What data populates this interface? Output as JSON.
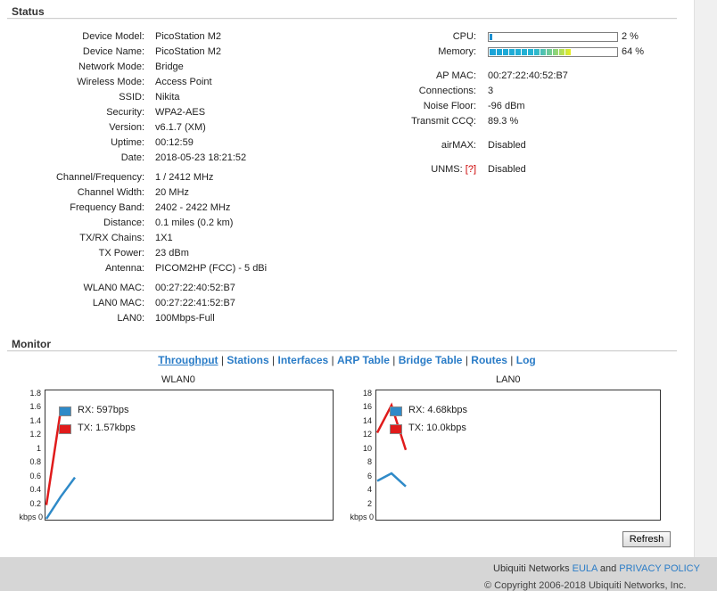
{
  "status": {
    "title": "Status",
    "left": [
      {
        "label": "Device Model:",
        "value": "PicoStation M2"
      },
      {
        "label": "Device Name:",
        "value": "PicoStation M2"
      },
      {
        "label": "Network Mode:",
        "value": "Bridge"
      },
      {
        "label": "Wireless Mode:",
        "value": "Access Point"
      },
      {
        "label": "SSID:",
        "value": "Nikita"
      },
      {
        "label": "Security:",
        "value": "WPA2-AES"
      },
      {
        "label": "Version:",
        "value": "v6.1.7 (XM)"
      },
      {
        "label": "Uptime:",
        "value": "00:12:59"
      },
      {
        "label": "Date:",
        "value": "2018-05-23 18:21:52"
      },
      {
        "label": "Channel/Frequency:",
        "value": "1 / 2412 MHz"
      },
      {
        "label": "Channel Width:",
        "value": "20 MHz"
      },
      {
        "label": "Frequency Band:",
        "value": "2402 - 2422 MHz"
      },
      {
        "label": "Distance:",
        "value": "0.1 miles (0.2 km)"
      },
      {
        "label": "TX/RX Chains:",
        "value": "1X1"
      },
      {
        "label": "TX Power:",
        "value": "23 dBm"
      },
      {
        "label": "Antenna:",
        "value": "PICOM2HP (FCC) - 5 dBi"
      },
      {
        "label": "WLAN0 MAC:",
        "value": "00:27:22:40:52:B7"
      },
      {
        "label": "LAN0 MAC:",
        "value": "00:27:22:41:52:B7"
      },
      {
        "label": "LAN0:",
        "value": "100Mbps-Full"
      }
    ],
    "cpu": {
      "label": "CPU:",
      "percent": 2,
      "text": "2 %"
    },
    "memory": {
      "label": "Memory:",
      "percent": 64,
      "text": "64 %"
    },
    "right": [
      {
        "label": "AP MAC:",
        "value": "00:27:22:40:52:B7"
      },
      {
        "label": "Connections:",
        "value": "3"
      },
      {
        "label": "Noise Floor:",
        "value": "-96 dBm"
      },
      {
        "label": "Transmit CCQ:",
        "value": "89.3 %"
      },
      {
        "label": "airMAX:",
        "value": "Disabled"
      }
    ],
    "unms": {
      "label": "UNMS:",
      "help": "[?]",
      "value": "Disabled"
    }
  },
  "monitor": {
    "title": "Monitor",
    "links": [
      "Throughput",
      "Stations",
      "Interfaces",
      "ARP Table",
      "Bridge Table",
      "Routes",
      "Log"
    ],
    "active_link": "Throughput",
    "refresh_label": "Refresh"
  },
  "chart_data": [
    {
      "type": "line",
      "title": "WLAN0",
      "ylabel": "kbps",
      "yticks": [
        "1.8",
        "1.6",
        "1.4",
        "1.2",
        "1",
        "0.8",
        "0.6",
        "0.4",
        "0.2",
        "kbps 0"
      ],
      "ylim": [
        0,
        1.8
      ],
      "series": [
        {
          "name": "RX: 597bps",
          "color": "#2f8ac8",
          "values": [
            0,
            0.32,
            0.6
          ]
        },
        {
          "name": "TX: 1.57kbps",
          "color": "#e01b1b",
          "values": [
            0.2,
            1.57
          ]
        }
      ]
    },
    {
      "type": "line",
      "title": "LAN0",
      "ylabel": "kbps",
      "yticks": [
        "18",
        "16",
        "14",
        "12",
        "10",
        "8",
        "6",
        "4",
        "2",
        "kbps 0"
      ],
      "ylim": [
        0,
        18
      ],
      "series": [
        {
          "name": "RX: 4.68kbps",
          "color": "#2f8ac8",
          "values": [
            5.5,
            6.6,
            4.7
          ]
        },
        {
          "name": "TX: 10.0kbps",
          "color": "#e01b1b",
          "values": [
            12.5,
            16.5,
            10.0
          ]
        }
      ]
    }
  ],
  "footer": {
    "company": "Ubiquiti Networks",
    "eula": "EULA",
    "and": "and",
    "privacy": "PRIVACY POLICY",
    "copyright": "© Copyright 2006-2018 Ubiquiti Networks, Inc."
  }
}
